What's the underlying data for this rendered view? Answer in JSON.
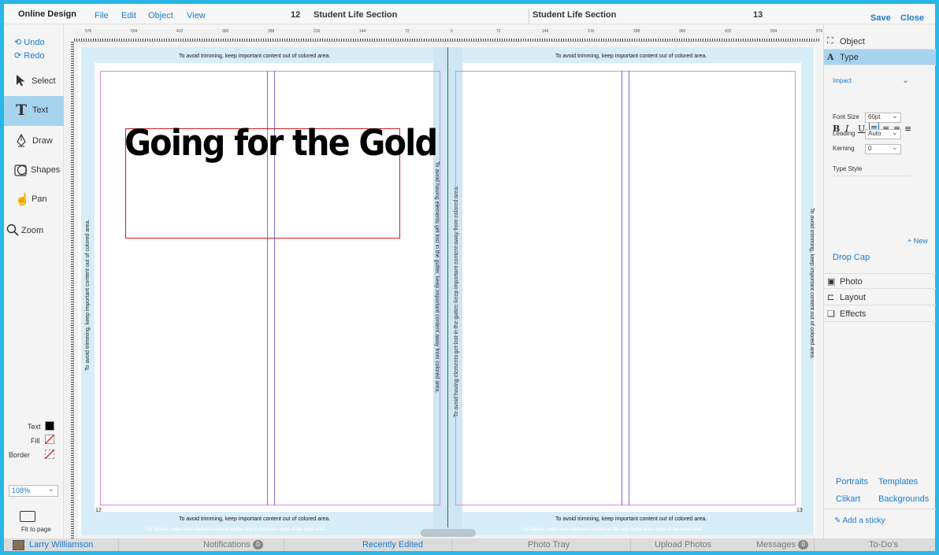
{
  "app": {
    "brand": "Online Design"
  },
  "menu": [
    "File",
    "Edit",
    "Object",
    "View"
  ],
  "pages": {
    "left_num": "12",
    "left_title": "Student Life Section",
    "right_title": "Student Life Section",
    "right_num": "13"
  },
  "actions": {
    "save": "Save",
    "close": "Close"
  },
  "history": {
    "undo": "Undo",
    "redo": "Redo"
  },
  "tools": [
    {
      "label": "Select",
      "icon": "arrow-icon"
    },
    {
      "label": "Text",
      "icon": "text-icon",
      "active": true
    },
    {
      "label": "Draw",
      "icon": "pen-icon"
    },
    {
      "label": "Shapes",
      "icon": "shapes-icon"
    },
    {
      "label": "Pan",
      "icon": "hand-icon"
    },
    {
      "label": "Zoom",
      "icon": "magnifier-icon"
    }
  ],
  "swatches": {
    "text": "Text",
    "fill": "Fill",
    "border": "Border",
    "text_color": "#000000"
  },
  "zoom": {
    "value": "108%"
  },
  "fit": {
    "label": "Fit to page"
  },
  "ruler": {
    "marks": [
      "576",
      "504",
      "432",
      "360",
      "288",
      "216",
      "144",
      "72",
      "0",
      "72",
      "144",
      "216",
      "288",
      "360",
      "432",
      "504",
      "576"
    ]
  },
  "canvas": {
    "bleed_note": "For bleeds, make sure elements extend all the way to the outer edge of the color area.",
    "trim_note": "To avoid trimming, keep important content out of colored area.",
    "gutter_note": "To avoid having elements get lost in the gutter, keep important content away from colored area.",
    "headline": "Going for the Gold",
    "left_page_num": "12",
    "right_page_num": "13"
  },
  "panel": {
    "object": "Object",
    "type": "Type",
    "font": "Impact",
    "format_buttons": [
      "B",
      "I",
      "U",
      "≡",
      "≡",
      "≡",
      "≡"
    ],
    "font_size_label": "Font Size",
    "font_size": "60pt",
    "leading_label": "Leading",
    "leading": "Auto",
    "kerning_label": "Kerning",
    "kerning": "0",
    "type_style": "Type Style",
    "new": "+ New",
    "drop_cap": "Drop Cap",
    "photo": "Photo",
    "layout": "Layout",
    "effects": "Effects",
    "portraits": "Portraits",
    "templates": "Templates",
    "clikart": "Clikart",
    "backgrounds": "Backgrounds",
    "sticky": "Add a sticky"
  },
  "status": {
    "user": "Larry Williamson",
    "notifications": "Notifications",
    "notifications_count": "0",
    "recently_edited": "Recently Edited",
    "photo_tray": "Photo Tray",
    "upload": "Upload Photos",
    "messages": "Messages",
    "messages_count": "0",
    "todos": "To-Do's"
  },
  "colors": {
    "accent": "#29b6e8",
    "link": "#1a7bd0",
    "bleed": "#d7eef8",
    "margin": "#d48cd9",
    "selection": "#d12020"
  }
}
